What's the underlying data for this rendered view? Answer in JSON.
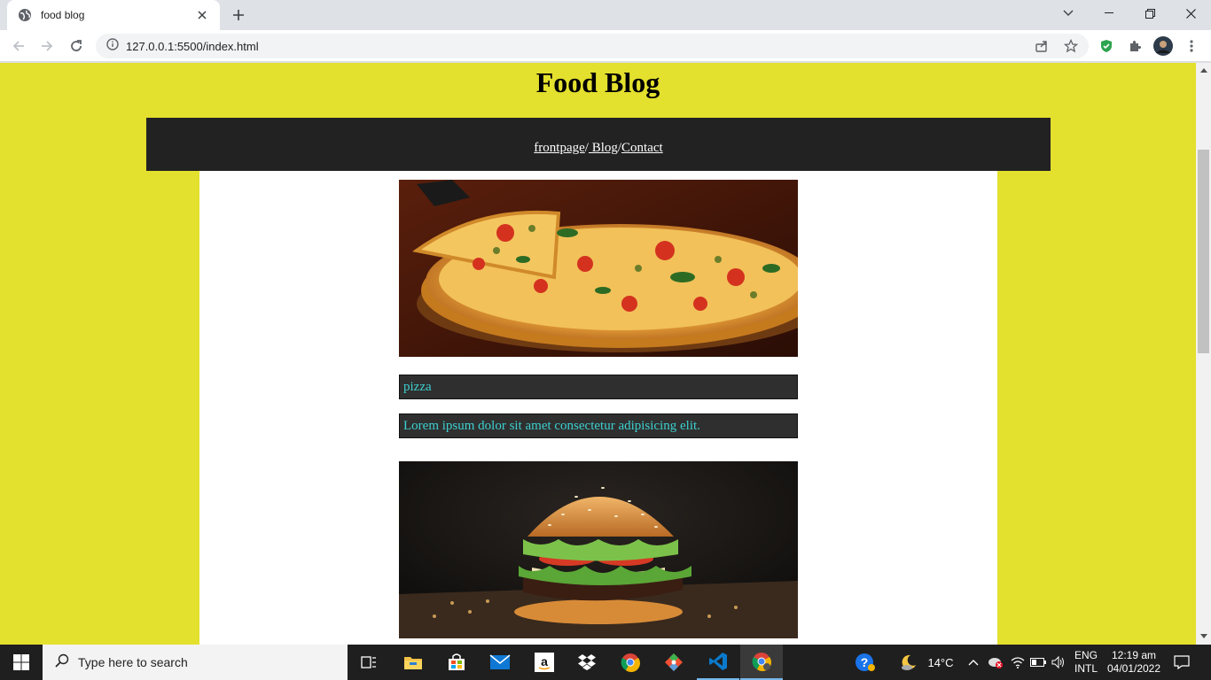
{
  "browser": {
    "tab_title": "food blog",
    "url": "127.0.0.1:5500/index.html"
  },
  "page": {
    "title": "Food Blog",
    "nav": {
      "links": [
        "frontpage",
        " Blog",
        "Contact"
      ],
      "separator": "/"
    },
    "posts": [
      {
        "image": "pizza-photo",
        "name": "pizza",
        "description": "Lorem ipsum dolor sit amet consectetur adipisicing elit."
      },
      {
        "image": "burger-photo"
      }
    ],
    "colors": {
      "page_bg": "#e3e02e",
      "nav_bg": "#222222",
      "box_bg": "#2f2f2f",
      "box_text": "#3ed0d0"
    }
  },
  "taskbar": {
    "search_placeholder": "Type here to search",
    "weather": "14°C",
    "lang_top": "ENG",
    "lang_bottom": "INTL",
    "time": "12:19 am",
    "date": "04/01/2022"
  }
}
